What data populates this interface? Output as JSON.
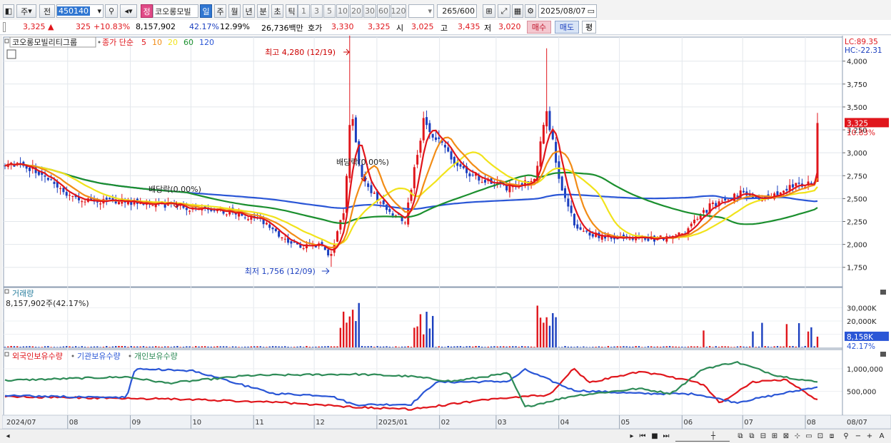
{
  "toolbar": {
    "market_tab": "주",
    "prev_tab": "전",
    "code": "450140",
    "stock_name": "코오롱모빌",
    "badge": "정",
    "period_tabs": [
      "일",
      "주",
      "월",
      "년",
      "분",
      "초",
      "틱"
    ],
    "interval_tabs": [
      "1",
      "3",
      "5",
      "10",
      "20",
      "30",
      "60",
      "120"
    ],
    "count": "265",
    "count_total": "/600",
    "date": "2025/08/07"
  },
  "quote": {
    "price": "3,325",
    "change_arrow": "▲",
    "change": "325",
    "change_pct": "+10.83%",
    "volume": "8,157,902",
    "volume_ratio": "42.17%",
    "turnover": "12.99%",
    "amount": "26,736백만",
    "ask_label": "호가",
    "ask": "3,330",
    "bid": "3,325",
    "open_label": "시",
    "open": "3,025",
    "high_label": "고",
    "high": "3,435",
    "low_label": "저",
    "low": "3,020",
    "buy_button": "매수",
    "sell_button": "매도",
    "eval_button": "평"
  },
  "chart_data": [
    {
      "type": "candlestick",
      "title": "코오롱모빌리티그룹",
      "legend": {
        "label": "종가 단순",
        "periods": [
          "5",
          "10",
          "20",
          "60",
          "120"
        ],
        "colors": [
          "#e0161c",
          "#f28c16",
          "#f1e31b",
          "#1b8f2e",
          "#2a56d6"
        ]
      },
      "ylim": [
        1600,
        4200
      ],
      "yticks": [
        "4,000",
        "3,750",
        "3,500",
        "3,250",
        "3,000",
        "2,750",
        "2,500",
        "2,250",
        "2,000",
        "1,750"
      ],
      "lc_label": "LC:89.35",
      "hc_label": "HC:-22.31",
      "current_price_label": "3,325",
      "current_change_label": "10.83%",
      "annotations": {
        "high": "최고 4,280 (12/19)",
        "low": "최저 1,756 (12/09)",
        "dividend_1": "배당락(0.00%)",
        "dividend_2": "배당락(0.00%)"
      },
      "anchor_prices": [
        {
          "date": "2024-07-01",
          "close": 2870
        },
        {
          "date": "2024-07-15",
          "close": 2820
        },
        {
          "date": "2024-08-05",
          "close": 2500
        },
        {
          "date": "2024-08-20",
          "close": 2470
        },
        {
          "date": "2024-09-10",
          "close": 2460
        },
        {
          "date": "2024-10-01",
          "close": 2390
        },
        {
          "date": "2024-10-20",
          "close": 2350
        },
        {
          "date": "2024-11-05",
          "close": 2250
        },
        {
          "date": "2024-11-20",
          "close": 1990
        },
        {
          "date": "2024-12-06",
          "close": 1980
        },
        {
          "date": "2024-12-09",
          "close": 1850
        },
        {
          "date": "2024-12-16",
          "close": 2400
        },
        {
          "date": "2024-12-19",
          "close": 3500
        },
        {
          "date": "2024-12-24",
          "close": 2780
        },
        {
          "date": "2025-01-02",
          "close": 2450
        },
        {
          "date": "2025-01-15",
          "close": 2250
        },
        {
          "date": "2025-01-24",
          "close": 3350
        },
        {
          "date": "2025-02-10",
          "close": 2850
        },
        {
          "date": "2025-02-25",
          "close": 2680
        },
        {
          "date": "2025-03-10",
          "close": 2600
        },
        {
          "date": "2025-03-20",
          "close": 2720
        },
        {
          "date": "2025-03-26",
          "close": 3450
        },
        {
          "date": "2025-04-02",
          "close": 2650
        },
        {
          "date": "2025-04-10",
          "close": 2150
        },
        {
          "date": "2025-04-25",
          "close": 2080
        },
        {
          "date": "2025-05-20",
          "close": 2060
        },
        {
          "date": "2025-06-02",
          "close": 2120
        },
        {
          "date": "2025-06-15",
          "close": 2420
        },
        {
          "date": "2025-06-30",
          "close": 2560
        },
        {
          "date": "2025-07-10",
          "close": 2480
        },
        {
          "date": "2025-07-25",
          "close": 2620
        },
        {
          "date": "2025-08-06",
          "close": 2700
        },
        {
          "date": "2025-08-07",
          "close": 3325
        }
      ]
    },
    {
      "type": "bar",
      "title": "거래량",
      "summary": "8,157,902주(42.17%)",
      "yticks": [
        "30,000K",
        "20,000K",
        "10,000K"
      ],
      "last_label": "8,158K",
      "last_pct": "42.17%"
    },
    {
      "type": "line",
      "legend": [
        "외국인보유수량",
        "기관보유수량",
        "개인보유수량"
      ],
      "colors": [
        "#e0161c",
        "#2a56d6",
        "#2e8b57"
      ],
      "yticks": [
        "1,000,000",
        "500,000"
      ]
    }
  ],
  "xaxis": [
    "2024/07",
    "08",
    "09",
    "10",
    "11",
    "12",
    "2025/01",
    "02",
    "03",
    "04",
    "05",
    "06",
    "07",
    "08",
    "08/07"
  ],
  "colors": {
    "up": "#e0161c",
    "down": "#1b3fbf",
    "accent": "#2f76d2"
  }
}
